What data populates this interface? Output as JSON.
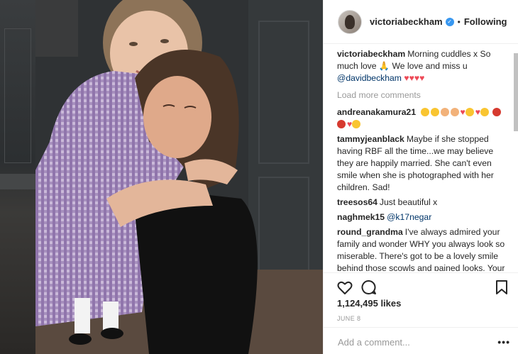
{
  "post": {
    "username": "victoriabeckham",
    "follow_state": "Following",
    "separator": "•"
  },
  "caption": {
    "username": "victoriabeckham",
    "text": "Morning cuddles x So much love 🙏 We love and miss u",
    "mention": "@davidbeckham"
  },
  "load_more": "Load more comments",
  "comments": [
    {
      "username": "andreanakamura21",
      "text": ""
    },
    {
      "username": "tammyjeanblack",
      "text": "Maybe if she stopped having RBF all the time...we may believe they are happily married. She can't even smile when she is photographed with her children. Sad!"
    },
    {
      "username": "treesos64",
      "text": "Just beautiful x"
    },
    {
      "username": "naghmek15",
      "mention": "@k17negar"
    },
    {
      "username": "round_grandma",
      "text": "I've always admired your family and wonder WHY you always look so miserable. There's got to be a lovely smile behind those scowls and pained looks. Your husband's beaming smile is always wonderful to see and unless this"
    }
  ],
  "likes": "1,124,495 likes",
  "date": "JUNE 8",
  "add_comment_placeholder": "Add a comment...",
  "more_label": "•••",
  "icons": {
    "like": "heart-icon",
    "comment": "speech-bubble-icon",
    "save": "bookmark-icon",
    "verified": "verified-badge-icon"
  },
  "colors": {
    "verified": "#3897f0",
    "mention": "#003569",
    "muted": "#999999",
    "heart": "#ed4956"
  }
}
